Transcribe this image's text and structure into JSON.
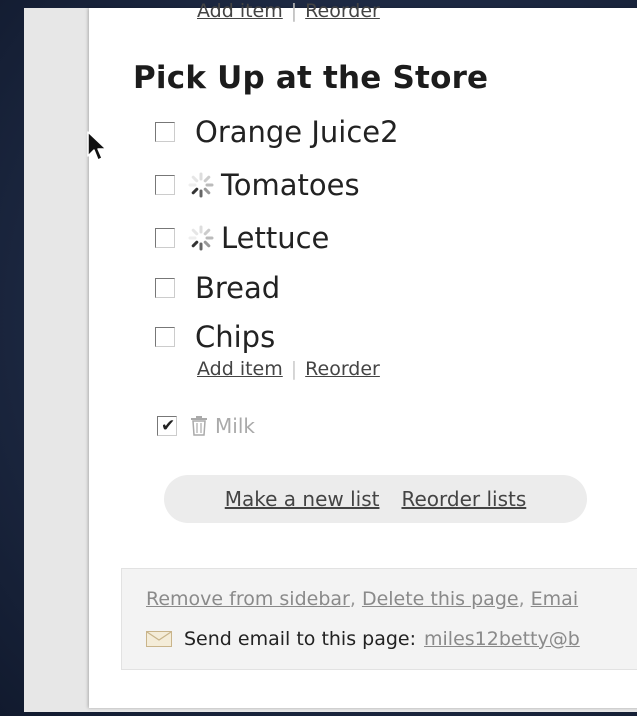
{
  "top_links": {
    "add_item": "Add item",
    "reorder": "Reorder"
  },
  "list": {
    "title": "Pick Up at the Store",
    "items": [
      {
        "label": "Orange Juice2",
        "loading": false
      },
      {
        "label": "Tomatoes",
        "loading": true
      },
      {
        "label": "Lettuce",
        "loading": true
      },
      {
        "label": "Bread",
        "loading": false
      },
      {
        "label": "Chips",
        "loading": false
      }
    ],
    "add_item_label": "Add item",
    "reorder_label": "Reorder"
  },
  "completed_items": [
    {
      "label": "Milk",
      "checked": true
    }
  ],
  "list_actions": {
    "new_list": "Make a new list",
    "reorder_lists": "Reorder lists"
  },
  "footer": {
    "remove_from_sidebar": "Remove from sidebar",
    "delete_page": "Delete this page",
    "email_truncated": "Emai",
    "send_email_label": "Send email to this page:",
    "email_address": "miles12betty@b"
  },
  "icons": {
    "checkbox": "checkbox-icon",
    "spinner": "loading-spinner-icon",
    "trash": "trash-icon",
    "envelope": "envelope-icon",
    "cursor": "mouse-pointer-icon"
  },
  "colors": {
    "background": "#1e2a44",
    "page": "#ffffff",
    "link_text": "#444444",
    "muted_text": "#aaaaaa"
  }
}
